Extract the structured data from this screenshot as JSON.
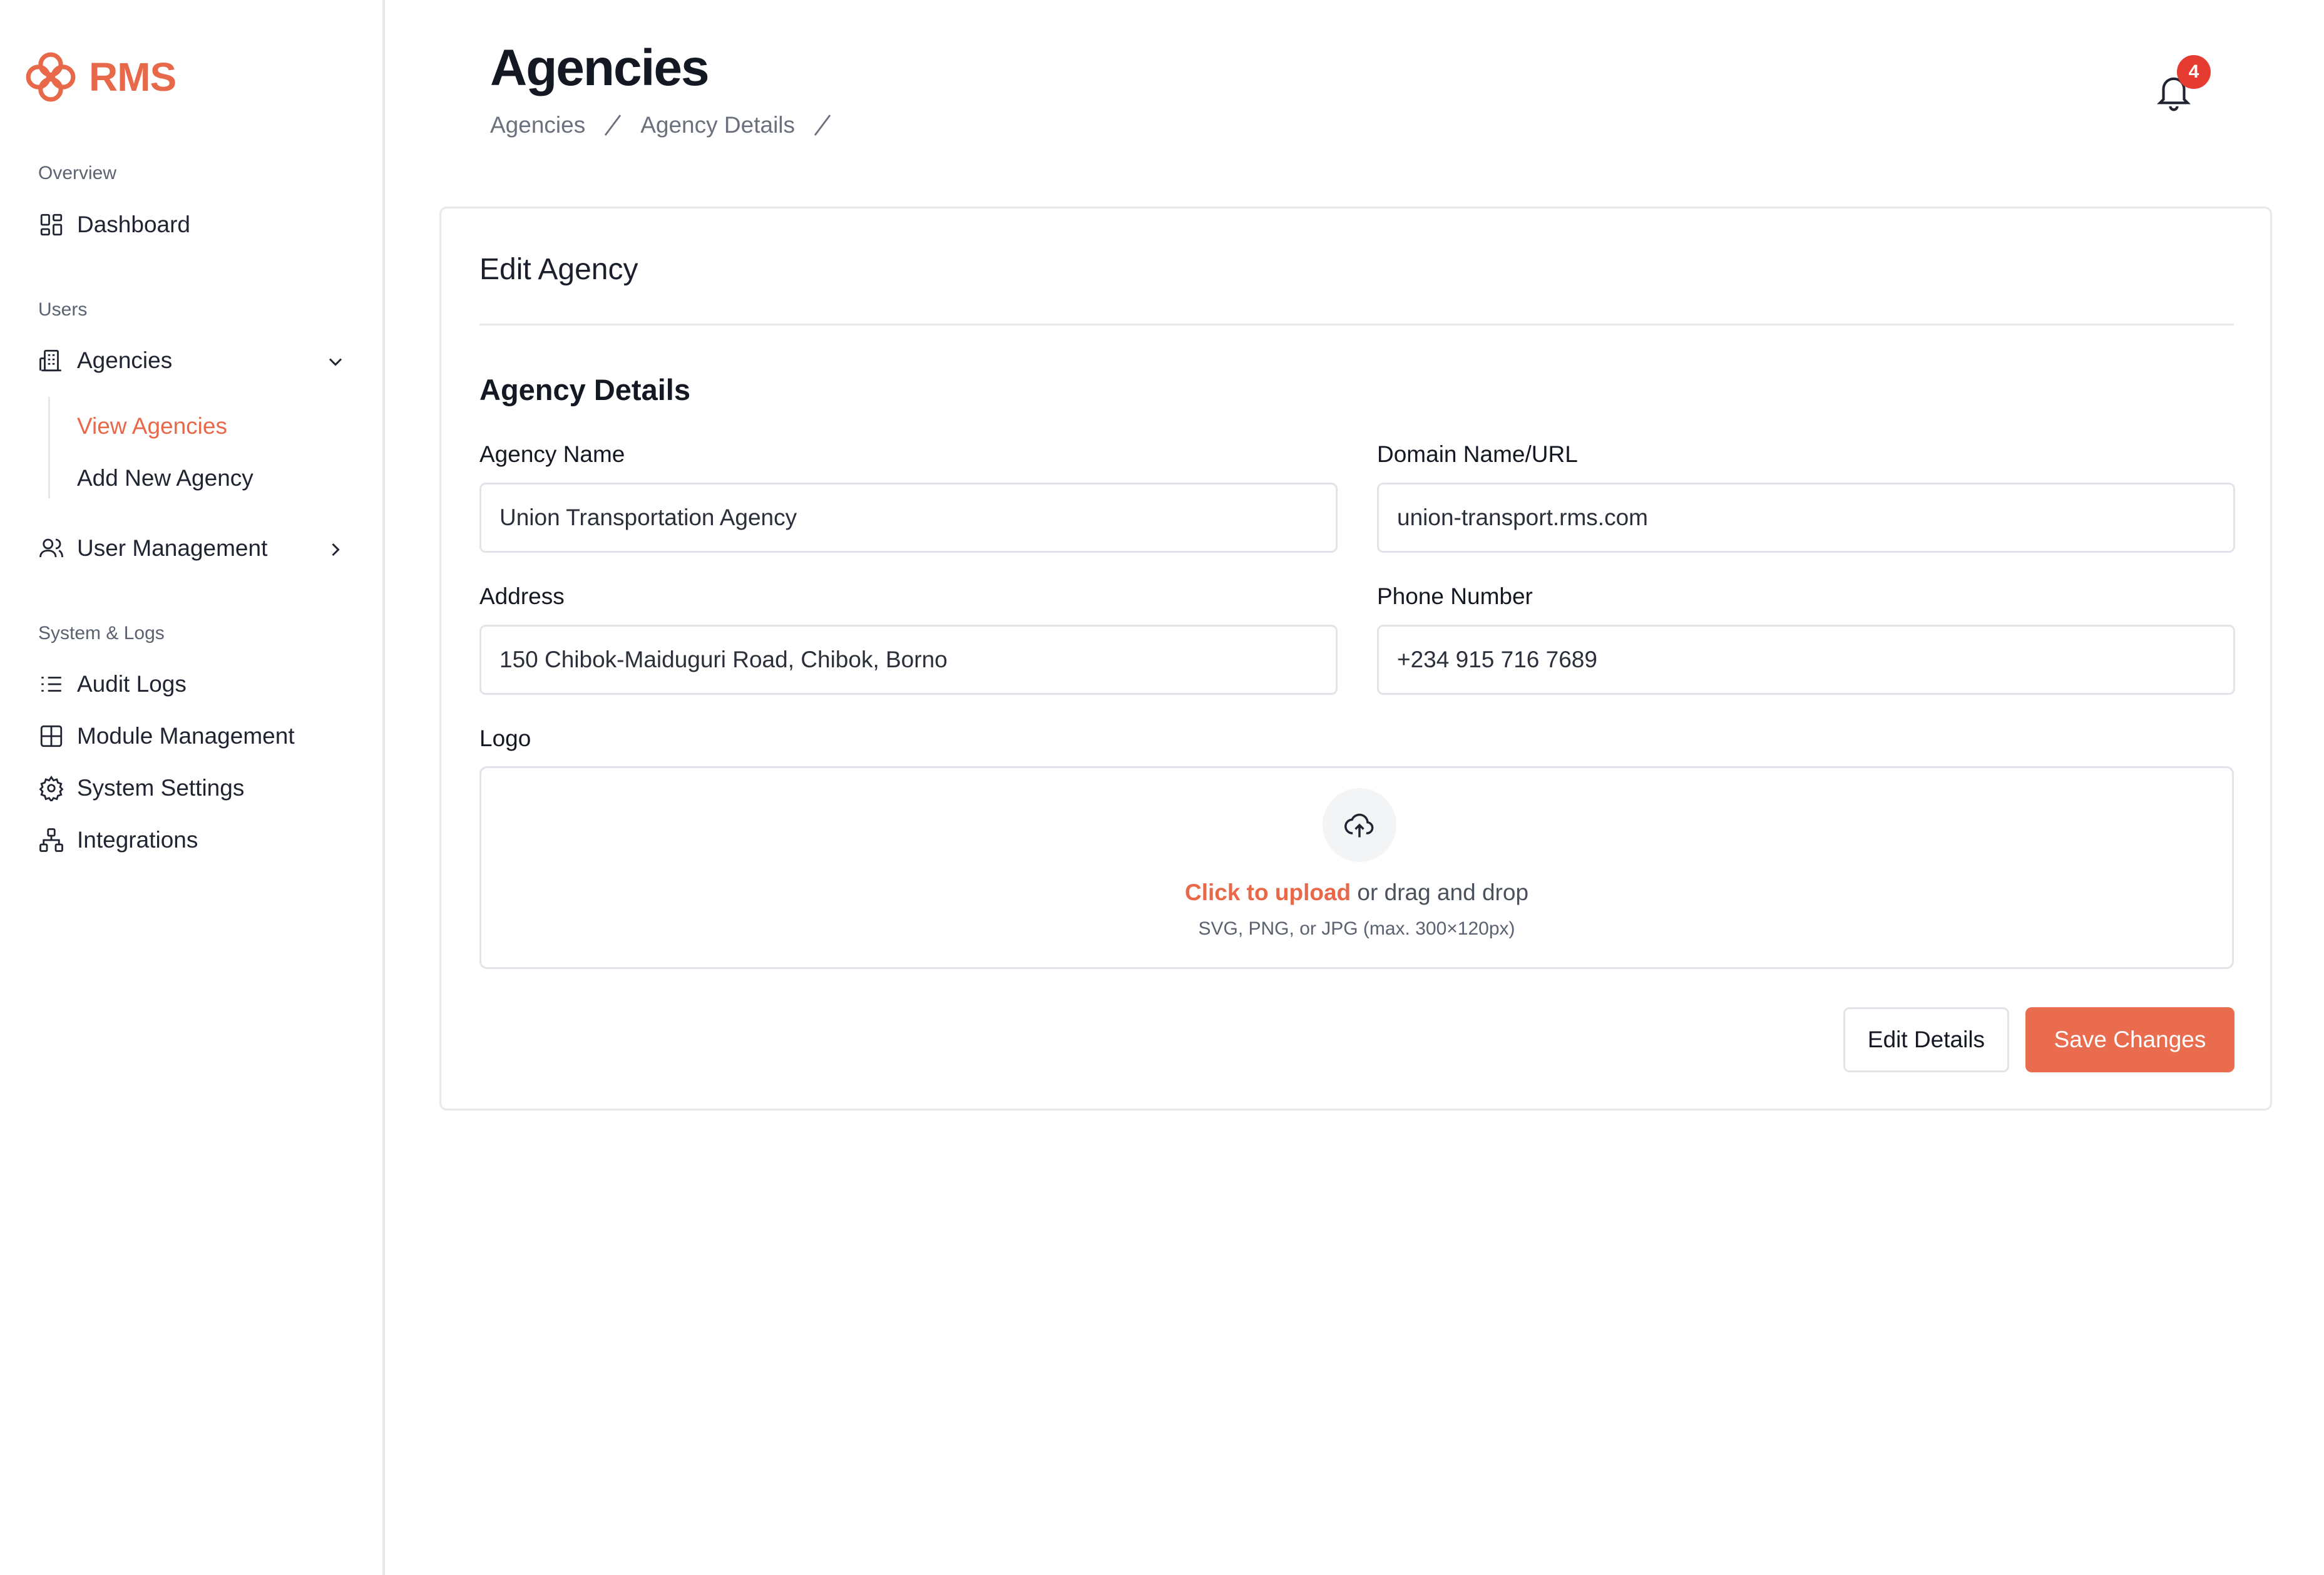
{
  "brand": {
    "name": "RMS",
    "color": "#e8684a"
  },
  "sidebar": {
    "sections": [
      {
        "label": "Overview"
      },
      {
        "label": "Users"
      },
      {
        "label": "System & Logs"
      }
    ],
    "items": {
      "dashboard": {
        "label": "Dashboard",
        "icon": "dashboard-grid-icon"
      },
      "agencies": {
        "label": "Agencies",
        "icon": "building-icon",
        "expanded": true
      },
      "view_agencies": {
        "label": "View Agencies",
        "active": true
      },
      "add_new_agency": {
        "label": "Add New Agency"
      },
      "user_management": {
        "label": "User Management",
        "icon": "users-icon"
      },
      "audit_logs": {
        "label": "Audit Logs",
        "icon": "list-icon"
      },
      "module_management": {
        "label": "Module Management",
        "icon": "layout-grid-icon"
      },
      "system_settings": {
        "label": "System Settings",
        "icon": "gear-icon"
      },
      "integrations": {
        "label": "Integrations",
        "icon": "network-icon"
      }
    }
  },
  "header": {
    "title": "Agencies",
    "breadcrumb": [
      "Agencies",
      "Agency Details"
    ],
    "notifications_count": "4"
  },
  "card": {
    "title": "Edit Agency",
    "section_title": "Agency Details",
    "fields": {
      "agency_name": {
        "label": "Agency Name",
        "value": "Union Transportation Agency"
      },
      "domain": {
        "label": "Domain Name/URL",
        "value": "union-transport.rms.com"
      },
      "address": {
        "label": "Address",
        "value": "150 Chibok-Maiduguri Road, Chibok, Borno"
      },
      "phone": {
        "label": "Phone Number",
        "value": "+234 915 716 7689"
      }
    },
    "logo": {
      "label": "Logo",
      "upload_link": "Click to upload",
      "upload_text": " or drag and drop",
      "hint": "SVG, PNG, or JPG (max. 300×120px)"
    },
    "buttons": {
      "edit": "Edit Details",
      "save": "Save Changes"
    }
  },
  "colors": {
    "accent": "#e96c4e",
    "badge": "#e53b30",
    "border": "#e1e4e8"
  }
}
